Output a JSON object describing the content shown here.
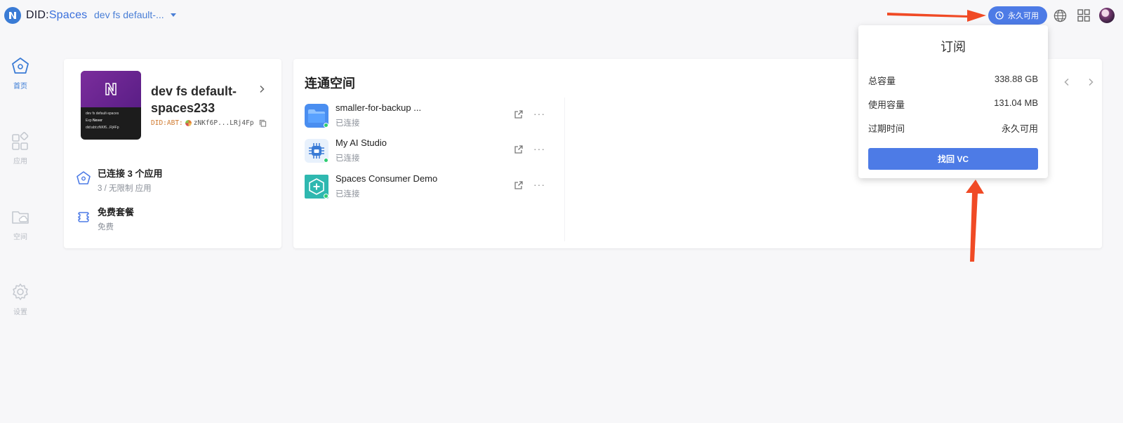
{
  "header": {
    "logo_did": "DID",
    "logo_sep": ":",
    "logo_spaces": "Spaces",
    "space_selector": "dev fs default-...",
    "subscription_label": "永久可用",
    "icons": [
      "clock-icon",
      "globe-icon",
      "apps-grid-icon",
      "avatar"
    ]
  },
  "sidebar": {
    "items": [
      {
        "label": "首页",
        "icon": "home-icon",
        "active": true
      },
      {
        "label": "应用",
        "icon": "apps-icon",
        "active": false
      },
      {
        "label": "空间",
        "icon": "folder-cloud-icon",
        "active": false
      },
      {
        "label": "设置",
        "icon": "gear-icon",
        "active": false
      }
    ]
  },
  "space_card": {
    "name": "dev fs default-spaces233",
    "did_prefix": "DID:ABT:",
    "did_value": "zNKf6P...LRj4Fp",
    "thumb": {
      "name": "dev fs default-spaces",
      "exp_label": "Exp",
      "exp_value": "Never",
      "did": "did:abt:zNKf6...Rj4Fp"
    },
    "stats": [
      {
        "title": "已连接 3 个应用",
        "sub": "3 / 无限制 应用",
        "icon": "home-icon"
      },
      {
        "title": "免费套餐",
        "sub": "免费",
        "icon": "plan-icon"
      }
    ]
  },
  "apps_card": {
    "title": "连通空间",
    "apps": [
      {
        "name": "smaller-for-backup ...",
        "status": "已连接",
        "icon": "folder-app-icon"
      },
      {
        "name": "My AI Studio",
        "status": "已连接",
        "icon": "ai-studio-icon"
      },
      {
        "name": "Spaces Consumer Demo",
        "status": "已连接",
        "icon": "consumer-demo-icon"
      }
    ]
  },
  "popup": {
    "title": "订阅",
    "rows": [
      {
        "label": "总容量",
        "value": "338.88 GB"
      },
      {
        "label": "使用容量",
        "value": "131.04 MB"
      },
      {
        "label": "过期时间",
        "value": "永久可用"
      }
    ],
    "button": "找回 VC"
  },
  "colors": {
    "accent": "#4d7be6",
    "annotation": "#f04a25",
    "connected": "#2ecc71"
  }
}
